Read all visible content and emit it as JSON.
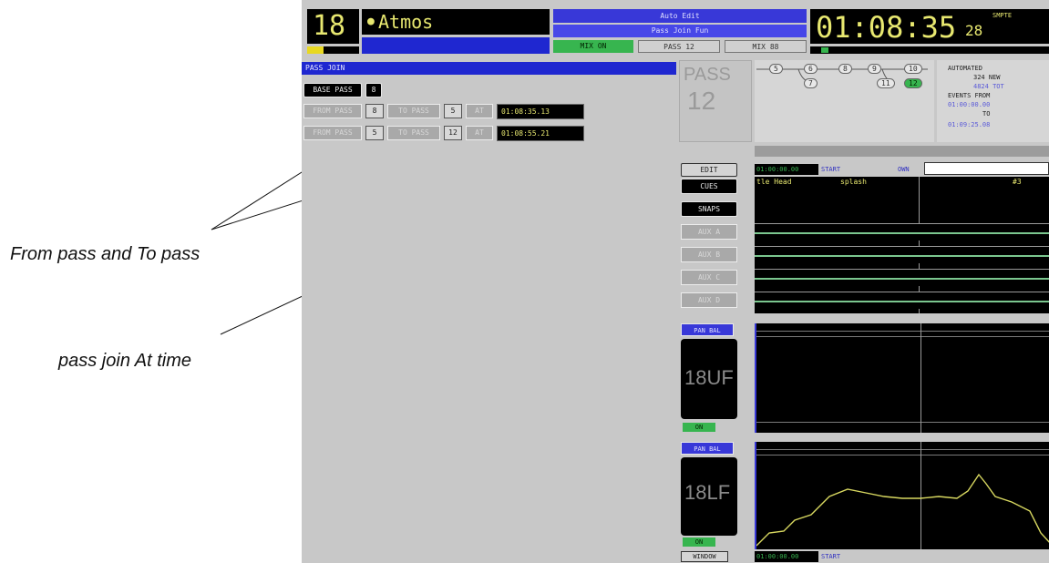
{
  "header": {
    "channel_number": "18",
    "channel_name": "Atmos",
    "mode_top": "Auto Edit",
    "mode_sub": "Pass Join Fun",
    "status_mix_on": "MIX ON",
    "status_pass": "PASS 12",
    "status_mix_off": "MIX 88",
    "timecode": "01:08:35",
    "timecode_frames": "28",
    "timecode_tag": "SMPTE"
  },
  "pass_join": {
    "title": "PASS JOIN",
    "base_pass_label": "BASE PASS",
    "base_pass_value": "8",
    "row1": {
      "from_label": "FROM PASS",
      "from_value": "8",
      "to_label": "TO PASS",
      "to_value": "5",
      "at_label": "AT",
      "at_time": "01:08:35.13"
    },
    "row2": {
      "from_label": "FROM PASS",
      "from_value": "5",
      "to_label": "TO PASS",
      "to_value": "12",
      "at_label": "AT",
      "at_time": "01:08:55.21"
    }
  },
  "pass_panel": {
    "label": "PASS",
    "number": "12",
    "tree": [
      "5",
      "6",
      "7",
      "8",
      "9",
      "10",
      "11",
      "12"
    ],
    "automated_label": "AUTOMATED",
    "new_count": "324 NEW",
    "total_count": "4824 TOT",
    "events_from_label": "EVENTS FROM",
    "events_from_time": "01:00:00.00",
    "to_label": "TO",
    "events_to_time": "01:09:25.08"
  },
  "timeline": {
    "edit_button": "EDIT",
    "start_time": "01:00:00.00",
    "start_label": "START",
    "own_label": "OWN",
    "cue_text_1": "tle Head",
    "cue_text_2": "splash",
    "cue_text_3": "#3",
    "side_buttons": [
      "CUES",
      "SNAPS",
      "AUX A",
      "AUX B",
      "AUX C",
      "AUX D"
    ]
  },
  "graph_panels": [
    {
      "header": "PAN BAL",
      "channel": "18UF",
      "status": "ON"
    },
    {
      "header": "PAN BAL",
      "channel": "18LF",
      "status": "ON"
    }
  ],
  "footer": {
    "window_button": "WINDOW",
    "start_time": "01:00:00.00",
    "start_label": "START"
  },
  "annotations": {
    "from_to": "From pass and To pass",
    "at_time": "pass join At time"
  }
}
